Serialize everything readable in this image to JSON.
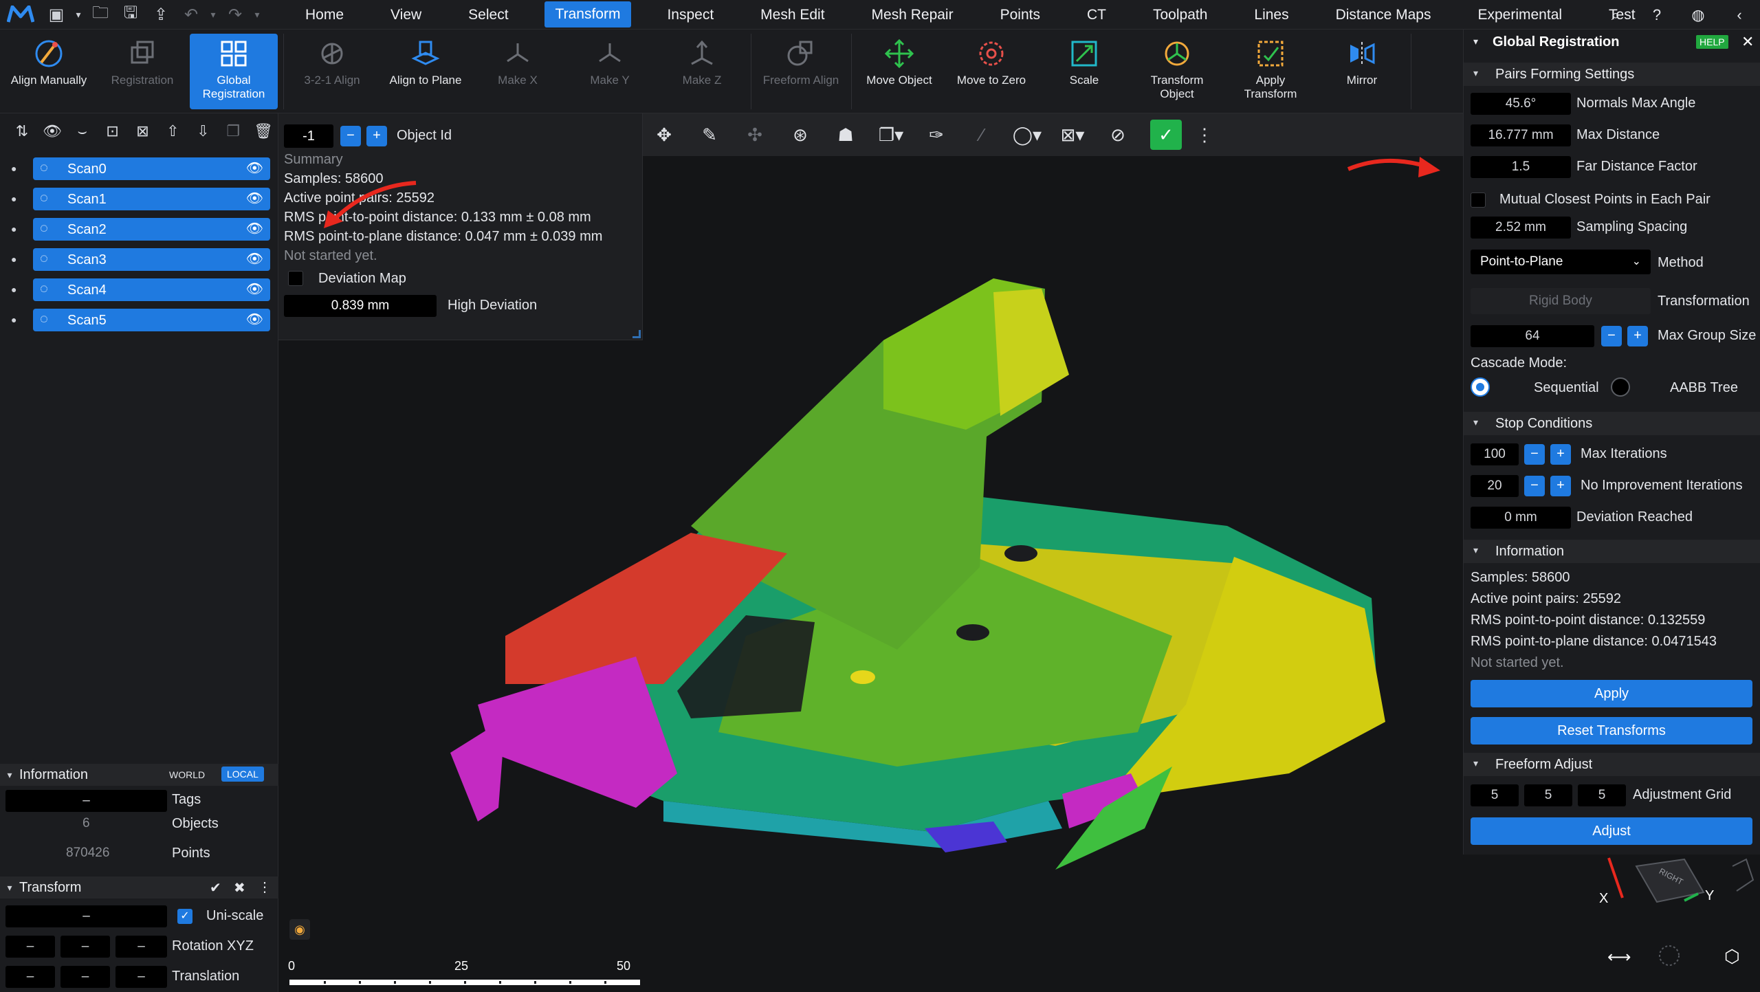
{
  "menubar": {
    "menus": [
      "Home",
      "View",
      "Select",
      "Transform",
      "Inspect",
      "Mesh Edit",
      "Mesh Repair",
      "Points",
      "CT",
      "Toolpath",
      "Lines",
      "Distance Maps",
      "Experimental",
      "Test"
    ],
    "active_menu": "Transform"
  },
  "ribbon": {
    "align_manually": "Align Manually",
    "registration": "Registration",
    "global_registration_l1": "Global",
    "global_registration_l2": "Registration",
    "align_321": "3-2-1 Align",
    "align_to_plane": "Align to Plane",
    "make_x": "Make X",
    "make_y": "Make Y",
    "make_z": "Make Z",
    "freeform_align": "Freeform Align",
    "move_object": "Move Object",
    "move_to_zero": "Move to Zero",
    "scale": "Scale",
    "transform_object_l1": "Transform",
    "transform_object_l2": "Object",
    "apply_transform_l1": "Apply",
    "apply_transform_l2": "Transform",
    "mirror": "Mirror"
  },
  "scans": [
    "Scan0",
    "Scan1",
    "Scan2",
    "Scan3",
    "Scan4",
    "Scan5"
  ],
  "info_panel": {
    "title": "Information",
    "world": "WORLD",
    "local": "LOCAL",
    "tags_value": "–",
    "tags_label": "Tags",
    "objects_value": "6",
    "objects_label": "Objects",
    "points_value": "870426",
    "points_label": "Points"
  },
  "transform_panel": {
    "title": "Transform",
    "uniscale_value": "–",
    "uniscale_label": "Uni-scale",
    "rot_x": "–",
    "rot_y": "–",
    "rot_z": "–",
    "rotation_label": "Rotation XYZ",
    "tr_x": "–",
    "tr_y": "–",
    "tr_z": "–",
    "translation_label": "Translation"
  },
  "reg_panel": {
    "object_id_value": "-1",
    "object_id_label": "Object Id",
    "summary": "Summary",
    "samples": "Samples: 58600",
    "pairs": "Active point pairs: 25592",
    "rms_pp": "RMS point-to-point distance: 0.133 mm ± 0.08 mm",
    "rms_pl": "RMS point-to-plane distance: 0.047 mm ± 0.039 mm",
    "status": "Not started yet.",
    "deviation_map": "Deviation Map",
    "high_dev_value": "0.839 mm",
    "high_dev_label": "High Deviation"
  },
  "scale_bar": {
    "t0": "0",
    "t1": "25",
    "t2": "50"
  },
  "global_registration": {
    "title": "Global Registration",
    "help": "HELP",
    "pairs_section": "Pairs Forming Settings",
    "normals_value": "45.6°",
    "normals_label": "Normals Max Angle",
    "max_dist_value": "16.777 mm",
    "max_dist_label": "Max Distance",
    "far_value": "1.5",
    "far_label": "Far Distance Factor",
    "mutual_label": "Mutual Closest Points in Each Pair",
    "sampling_value": "2.52 mm",
    "sampling_label": "Sampling Spacing",
    "method_value": "Point-to-Plane",
    "method_label": "Method",
    "transform_value": "Rigid Body",
    "transform_label": "Transformation",
    "group_value": "64",
    "group_label": "Max Group Size",
    "cascade_label": "Cascade Mode:",
    "sequential": "Sequential",
    "aabb": "AABB Tree",
    "stop_section": "Stop Conditions",
    "max_iter_value": "100",
    "max_iter_label": "Max Iterations",
    "no_impr_value": "20",
    "no_impr_label": "No Improvement Iterations",
    "dev_reached_value": "0 mm",
    "dev_reached_label": "Deviation Reached",
    "info_section": "Information",
    "samples": "Samples: 58600",
    "pairs": "Active point pairs: 25592",
    "rms_pp": "RMS point-to-point distance: 0.132559",
    "rms_pl": "RMS point-to-plane distance: 0.0471543",
    "status": "Not started yet.",
    "apply": "Apply",
    "reset": "Reset Transforms",
    "freeform_section": "Freeform Adjust",
    "grid_x": "5",
    "grid_y": "5",
    "grid_z": "5",
    "grid_label": "Adjustment Grid",
    "adjust": "Adjust"
  },
  "gizmo": {
    "x": "X",
    "y": "Y",
    "face": "RIGHT"
  },
  "colors": {
    "accent": "#1f7ae0",
    "ok": "#21b24b",
    "annotation": "#e8281e"
  }
}
